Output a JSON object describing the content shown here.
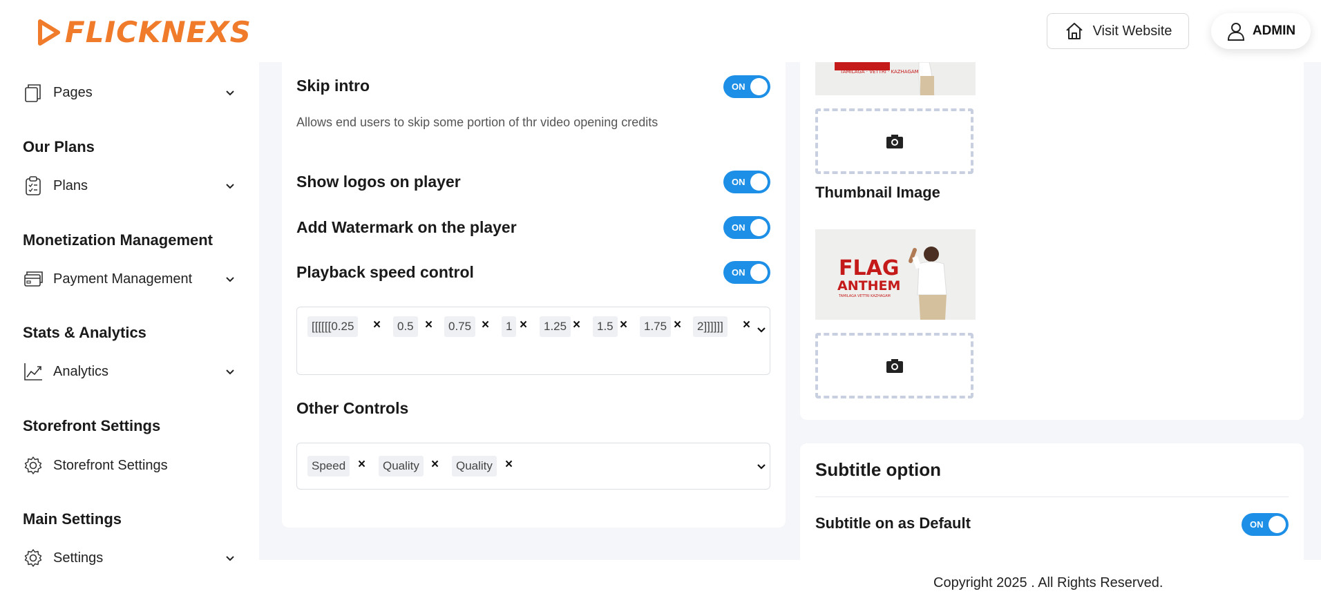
{
  "brand": {
    "name": "FLICKNEXS",
    "color": "#f07b2a"
  },
  "header": {
    "visit_label": "Visit Website",
    "admin_label": "ADMIN"
  },
  "sidebar": {
    "items": [
      {
        "label": "Pages",
        "icon": "pages-icon"
      },
      {
        "heading": "Our Plans"
      },
      {
        "label": "Plans",
        "icon": "clipboard-icon"
      },
      {
        "heading": "Monetization Management"
      },
      {
        "label": "Payment Management",
        "icon": "credit-card-icon"
      },
      {
        "heading": "Stats & Analytics"
      },
      {
        "label": "Analytics",
        "icon": "chart-line-icon"
      },
      {
        "heading": "Storefront Settings"
      },
      {
        "label": "Storefront Settings",
        "icon": "gear-icon"
      },
      {
        "heading": "Main Settings"
      },
      {
        "label": "Settings",
        "icon": "gear-icon"
      }
    ]
  },
  "player_settings": {
    "skip_intro": {
      "label": "Skip intro",
      "state": "ON",
      "description": "Allows end users to skip some portion of thr video opening credits"
    },
    "show_logos": {
      "label": "Show logos on player",
      "state": "ON"
    },
    "watermark": {
      "label": "Add Watermark on the player",
      "state": "ON"
    },
    "playback_speed": {
      "label": "Playback speed control",
      "state": "ON",
      "chips": [
        "[[[[[[0.25",
        "0.5",
        "0.75",
        "1",
        "1.25",
        "1.5",
        "1.75",
        "2]]]]]]"
      ]
    },
    "other_controls": {
      "label": "Other Controls",
      "chips": [
        "Speed",
        "Quality",
        "Quality"
      ]
    }
  },
  "media": {
    "thumbnail_label": "Thumbnail Image",
    "poster_title": "FLAG",
    "poster_subtitle": "ANTHEM",
    "poster_credit": "TAMILAGA VETTRI KAZHAGAM"
  },
  "subtitle": {
    "title": "Subtitle option",
    "default_label": "Subtitle on as Default",
    "state": "ON"
  },
  "footer": {
    "text": "Copyright 2025  . All Rights Reserved."
  },
  "colors": {
    "toggle_on": "#1d8fe6",
    "page_bg": "#f4f6f9"
  }
}
